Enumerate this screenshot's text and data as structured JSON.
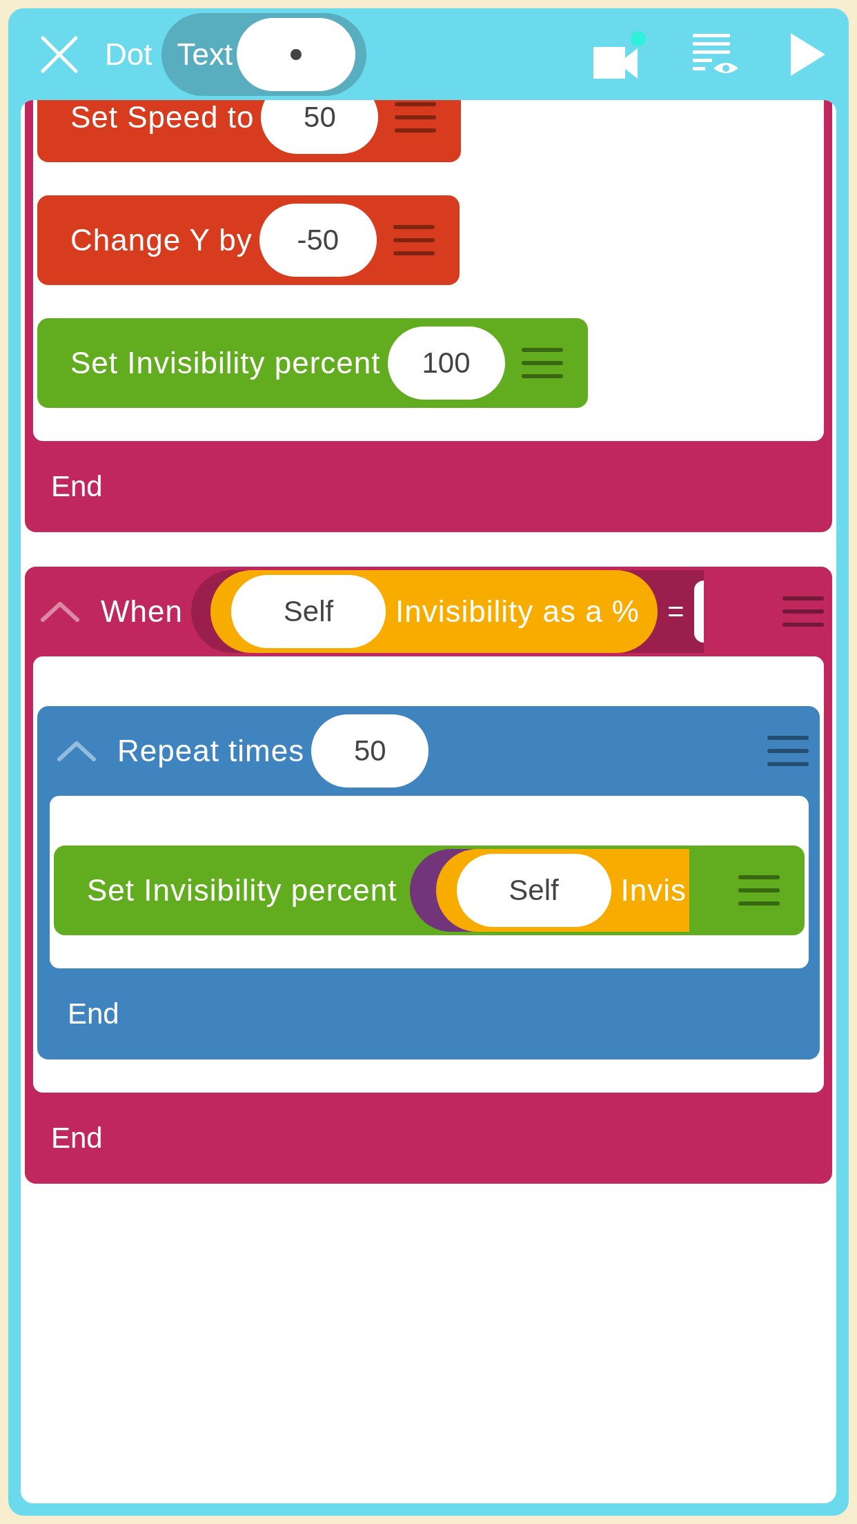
{
  "header": {
    "sprite_name": "Dot",
    "toggle_label": "Text",
    "recording_dot": true
  },
  "scripts": [
    {
      "kind": "container",
      "color": "#c0285d",
      "end": "End",
      "children": [
        {
          "kind": "command",
          "color": "#d83c1e",
          "label": "Set Speed to",
          "value": "50"
        },
        {
          "kind": "command",
          "color": "#d83c1e",
          "label": "Change Y by",
          "value": "-50"
        },
        {
          "kind": "command",
          "color": "#62ad1f",
          "label": "Set Invisibility percent",
          "value": "100"
        }
      ]
    },
    {
      "kind": "container",
      "color": "#c0285d",
      "label": "When",
      "expanded": true,
      "condition": {
        "target": "Self",
        "property": "Invisibility as a %",
        "operator": "="
      },
      "end": "End",
      "children": [
        {
          "kind": "container",
          "color": "#3f83bf",
          "label": "Repeat times",
          "value": "50",
          "expanded": true,
          "end": "End",
          "children": [
            {
              "kind": "command",
              "color": "#62ad1f",
              "label": "Set Invisibility percent",
              "expression": {
                "target": "Self",
                "property": "Invis"
              }
            }
          ]
        }
      ]
    }
  ]
}
